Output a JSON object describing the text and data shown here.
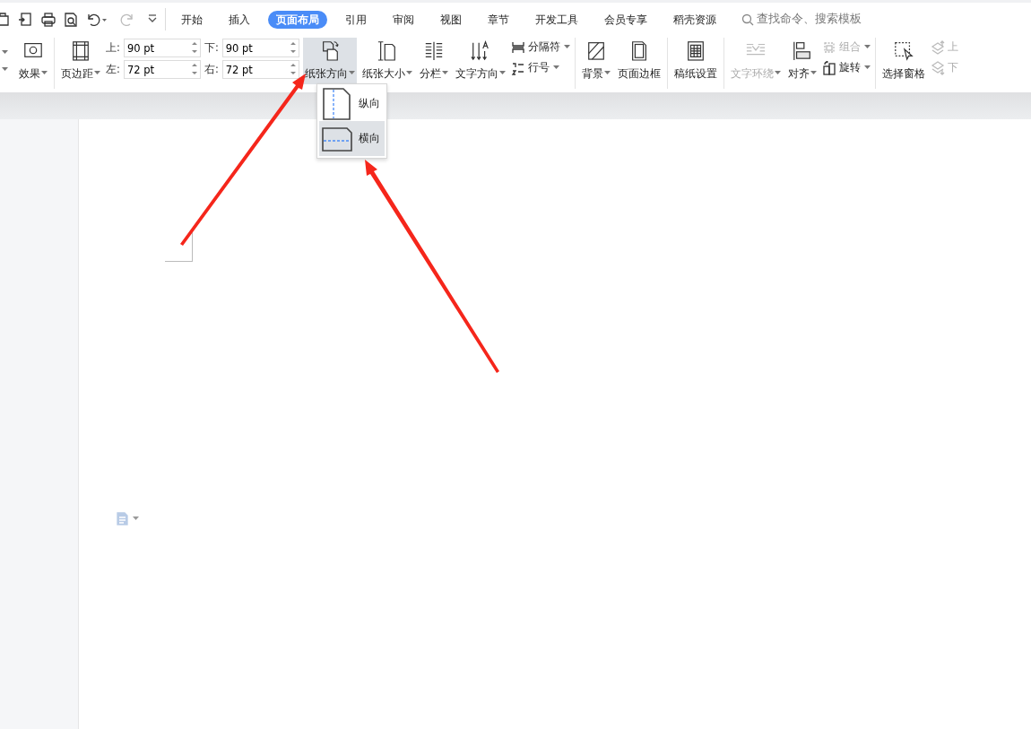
{
  "quick_access": {
    "redo_disabled": true
  },
  "tabs": [
    {
      "label": "开始",
      "selected": false
    },
    {
      "label": "插入",
      "selected": false
    },
    {
      "label": "页面布局",
      "selected": true
    },
    {
      "label": "引用",
      "selected": false
    },
    {
      "label": "审阅",
      "selected": false
    },
    {
      "label": "视图",
      "selected": false
    },
    {
      "label": "章节",
      "selected": false
    },
    {
      "label": "开发工具",
      "selected": false
    },
    {
      "label": "会员专享",
      "selected": false
    },
    {
      "label": "稻壳资源",
      "selected": false
    }
  ],
  "search": {
    "placeholder": "查找命令、搜索模板"
  },
  "ribbon": [
    {
      "items": [
        {
          "kind": "large",
          "label": "效果",
          "dropdown": true,
          "disabled": false,
          "expanded": false
        }
      ]
    },
    {
      "items": [
        {
          "kind": "large",
          "label": "页边距",
          "dropdown": true,
          "disabled": false,
          "expanded": false
        },
        {
          "kind": "fields",
          "fields": [
            {
              "label": "上:",
              "value": "90 pt"
            },
            {
              "label": "下:",
              "value": "90 pt"
            },
            {
              "label": "左:",
              "value": "72 pt"
            },
            {
              "label": "右:",
              "value": "72 pt"
            }
          ]
        },
        {
          "kind": "large",
          "label": "纸张方向",
          "dropdown": true,
          "disabled": false,
          "expanded": true
        },
        {
          "kind": "large",
          "label": "纸张大小",
          "dropdown": true,
          "disabled": false,
          "expanded": false
        },
        {
          "kind": "large",
          "label": "分栏",
          "dropdown": true,
          "disabled": false,
          "expanded": false
        },
        {
          "kind": "large",
          "label": "文字方向",
          "dropdown": true,
          "disabled": false,
          "expanded": false
        },
        {
          "kind": "stack",
          "rows": [
            {
              "label": "分隔符",
              "dropdown": true,
              "disabled": false
            },
            {
              "label": "行号",
              "dropdown": true,
              "disabled": false
            }
          ]
        }
      ]
    },
    {
      "items": [
        {
          "kind": "large",
          "label": "背景",
          "dropdown": true,
          "disabled": false,
          "expanded": false
        },
        {
          "kind": "large",
          "label": "页面边框",
          "dropdown": false,
          "disabled": false,
          "expanded": false
        }
      ]
    },
    {
      "items": [
        {
          "kind": "large",
          "label": "稿纸设置",
          "dropdown": false,
          "disabled": false,
          "expanded": false
        }
      ]
    },
    {
      "items": [
        {
          "kind": "large",
          "label": "文字环绕",
          "dropdown": true,
          "disabled": true,
          "expanded": false
        },
        {
          "kind": "large",
          "label": "对齐",
          "dropdown": true,
          "disabled": false,
          "expanded": false
        },
        {
          "kind": "stack",
          "rows": [
            {
              "label": "组合",
              "dropdown": true,
              "disabled": true
            },
            {
              "label": "旋转",
              "dropdown": true,
              "disabled": false
            }
          ]
        }
      ]
    },
    {
      "items": [
        {
          "kind": "large",
          "label": "选择窗格",
          "dropdown": false,
          "disabled": false,
          "expanded": false
        },
        {
          "kind": "stack",
          "rows": [
            {
              "label": "上",
              "dropdown": false,
              "disabled": true
            },
            {
              "label": "下",
              "dropdown": false,
              "disabled": true
            }
          ]
        }
      ]
    }
  ],
  "orientation_menu": [
    {
      "label": "纵向",
      "selected": false
    },
    {
      "label": "横向",
      "selected": true
    }
  ]
}
